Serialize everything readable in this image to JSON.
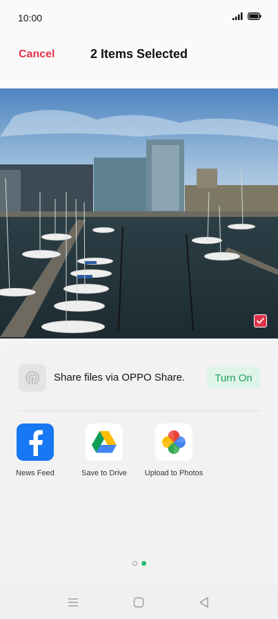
{
  "status_bar": {
    "time": "10:00",
    "signal_icon": "signal-icon",
    "battery_icon": "battery-icon"
  },
  "header": {
    "cancel_label": "Cancel",
    "title": "2 Items Selected"
  },
  "photo": {
    "selected_icon": "checkmark-icon"
  },
  "share": {
    "oppo_share_text": "Share files via OPPO Share.",
    "turn_on_label": "Turn On",
    "apps": [
      {
        "label": "News Feed",
        "icon": "facebook-icon"
      },
      {
        "label": "Save to Drive",
        "icon": "google-drive-icon"
      },
      {
        "label": "Upload to Photos",
        "icon": "google-photos-icon"
      }
    ],
    "page_count": 2,
    "current_page": 2
  },
  "nav": {
    "menu_icon": "menu-icon",
    "home_icon": "home-icon",
    "back_icon": "back-icon"
  },
  "colors": {
    "accent_red": "#e0334a",
    "accent_green": "#1ec070"
  }
}
